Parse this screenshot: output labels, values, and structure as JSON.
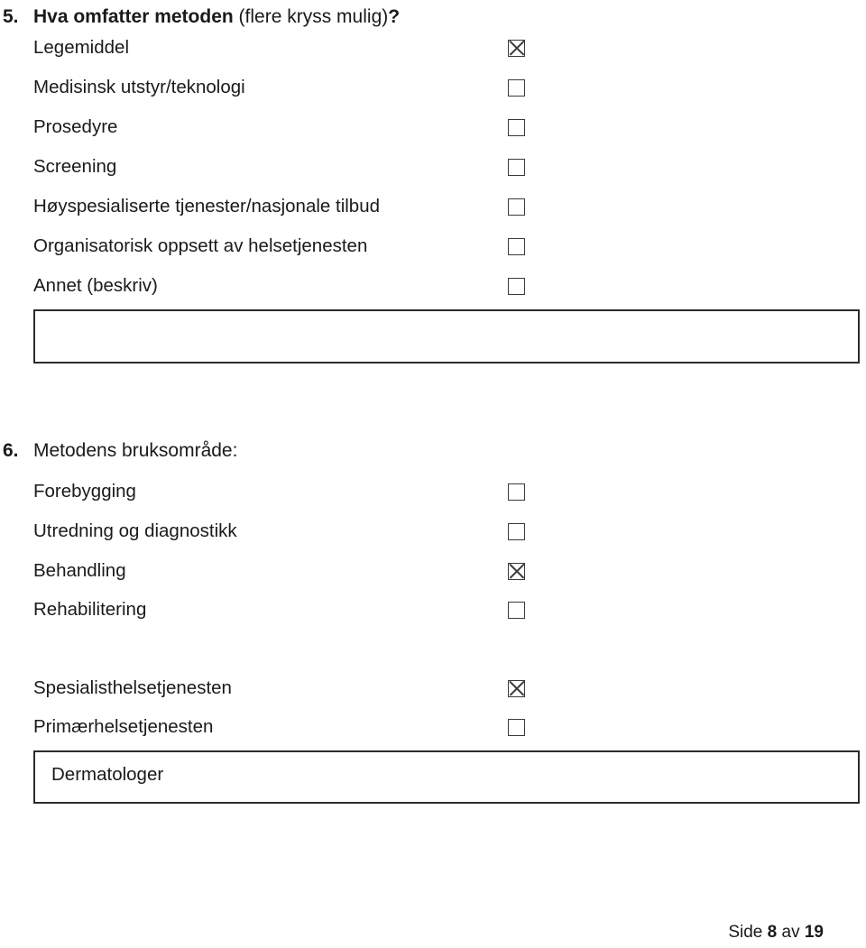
{
  "document": {
    "background_color": "#ffffff",
    "text_color": "#1a1a1a"
  },
  "question5": {
    "number": "5.",
    "title_bold": "Hva omfatter metoden",
    "title_regular": " (flere kryss mulig)",
    "title_bold_end": "?",
    "options": [
      {
        "label": "Legemiddel",
        "checked": true
      },
      {
        "label": "Medisinsk utstyr/teknologi",
        "checked": false
      },
      {
        "label": "Prosedyre",
        "checked": false
      },
      {
        "label": "Screening",
        "checked": false
      },
      {
        "label": "Høyspesialiserte tjenester/nasjonale tilbud",
        "checked": false
      },
      {
        "label": "Organisatorisk oppsett av helsetjenesten",
        "checked": false
      },
      {
        "label": "Annet (beskriv)",
        "checked": false
      }
    ],
    "textbox_value": ""
  },
  "question6": {
    "number": "6.",
    "title_bold": "Metodens bruksområde:",
    "options": [
      {
        "label": "Forebygging",
        "checked": false
      },
      {
        "label": "Utredning og diagnostikk",
        "checked": false
      },
      {
        "label": "Behandling",
        "checked": true
      },
      {
        "label": "Rehabilitering",
        "checked": false
      }
    ],
    "options_group2": [
      {
        "label": "Spesialisthelsetjenesten",
        "checked": true
      },
      {
        "label": "Primærhelsetjenesten",
        "checked": false
      }
    ],
    "textbox_value": "Dermatologer"
  },
  "footer": {
    "prefix": "Side ",
    "page_number": "8",
    "middle": " av ",
    "total_pages": "19"
  }
}
